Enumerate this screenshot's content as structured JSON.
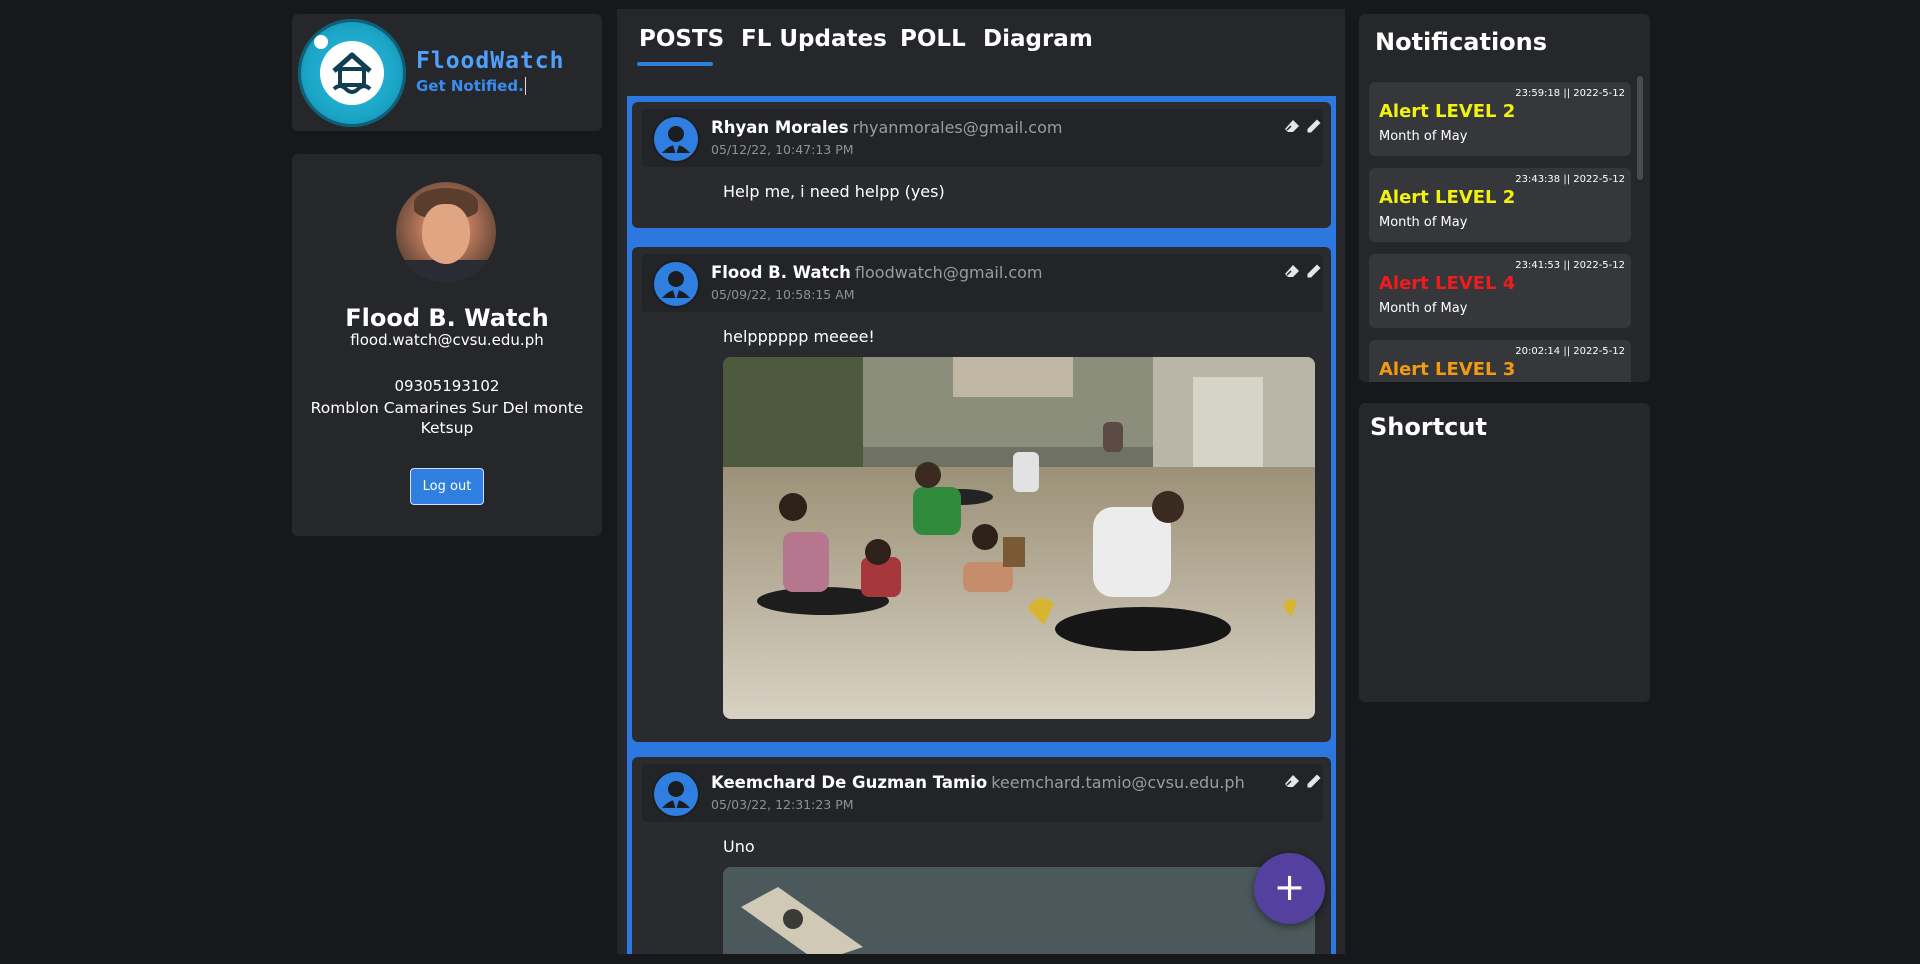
{
  "brand": {
    "title": "FloodWatch",
    "subtitle": "Get Notified."
  },
  "profile": {
    "name": "Flood B. Watch",
    "email": "flood.watch@cvsu.edu.ph",
    "phone": "09305193102",
    "address": "Romblon Camarines Sur Del monte Ketsup",
    "logout_label": "Log out"
  },
  "tabs": [
    {
      "label": "POSTS",
      "active": true
    },
    {
      "label": "FL Updates",
      "active": false
    },
    {
      "label": "POLL",
      "active": false
    },
    {
      "label": "Diagram",
      "active": false
    }
  ],
  "posts": [
    {
      "name": "Rhyan Morales",
      "email": "rhyanmorales@gmail.com",
      "date": "05/12/22, 10:47:13 PM",
      "text": "Help me, i need helpp (yes)"
    },
    {
      "name": "Flood B. Watch",
      "email": "floodwatch@gmail.com",
      "date": "05/09/22, 10:58:15 AM",
      "text": "helpppppp meeee!"
    },
    {
      "name": "Keemchard De Guzman Tamio",
      "email": "keemchard.tamio@cvsu.edu.ph",
      "date": "05/03/22, 12:31:23 PM",
      "text": "Uno"
    }
  ],
  "fab_label": "+",
  "notifications": {
    "title": "Notifications",
    "items": [
      {
        "time": "23:59:18 || 2022-5-12",
        "title": "Alert LEVEL 2",
        "subtitle": "Month of May",
        "color": "#f2f20f"
      },
      {
        "time": "23:43:38 || 2022-5-12",
        "title": "Alert LEVEL 2",
        "subtitle": "Month of May",
        "color": "#f2f20f"
      },
      {
        "time": "23:41:53 || 2022-5-12",
        "title": "Alert LEVEL 4",
        "subtitle": "Month of May",
        "color": "#ee1c1c"
      },
      {
        "time": "20:02:14 || 2022-5-12",
        "title": "Alert LEVEL 3",
        "subtitle": "",
        "color": "#f29a12"
      }
    ]
  },
  "shortcut": {
    "title": "Shortcut"
  },
  "colors": {
    "accent": "#2f7fe0",
    "background": "#17181a",
    "card": "#26272a",
    "fab": "#53409f"
  }
}
